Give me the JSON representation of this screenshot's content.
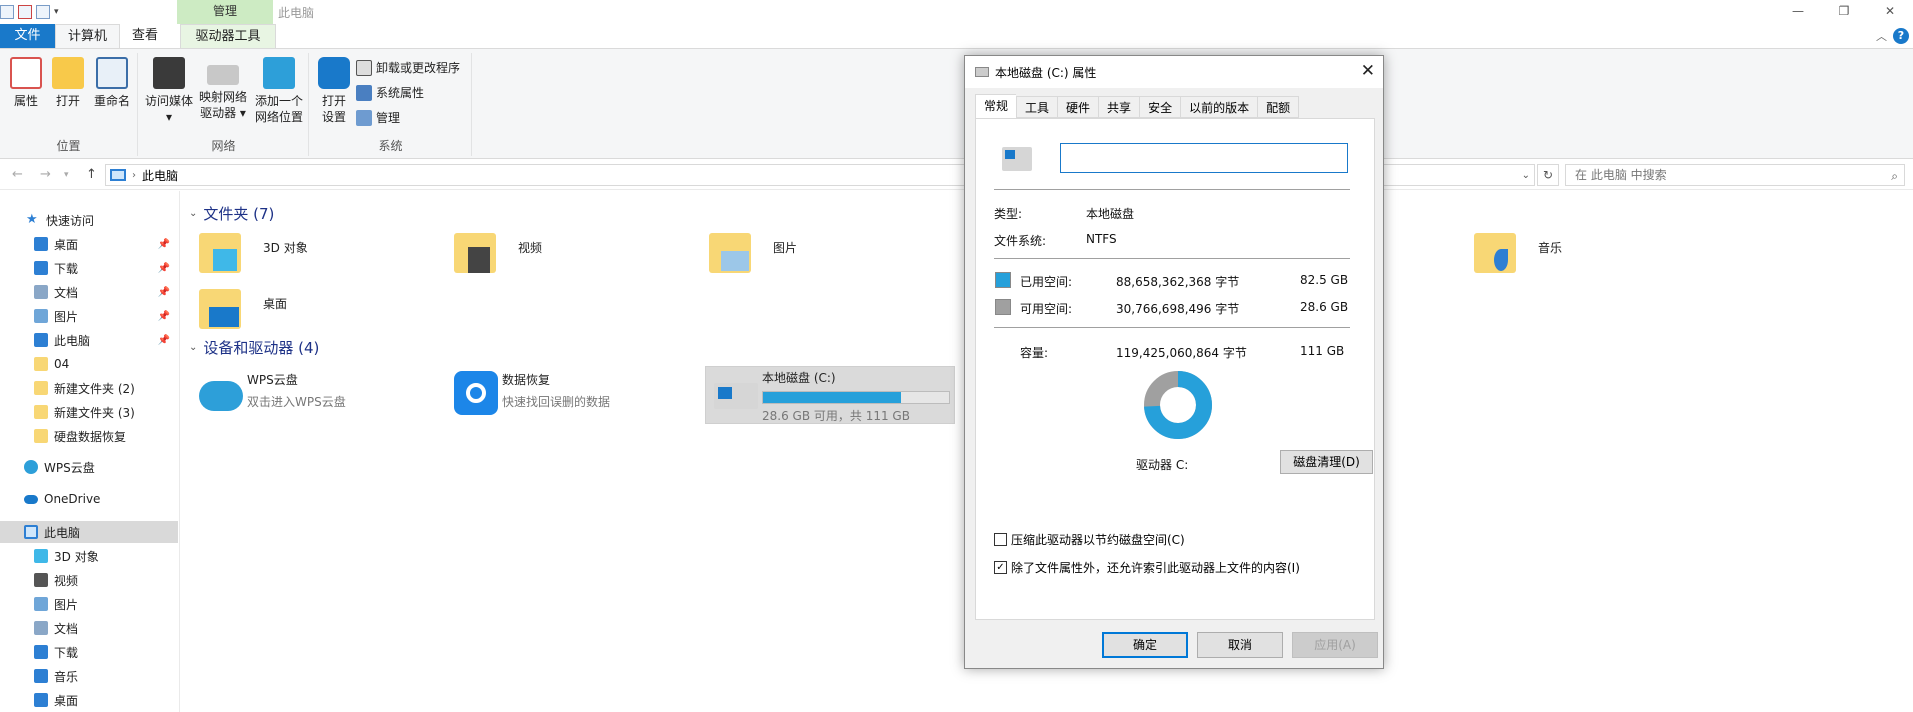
{
  "window": {
    "title": "此电脑",
    "context_tab": "管理",
    "controls": [
      "—",
      "❐",
      "✕"
    ]
  },
  "tabs": [
    {
      "label": "文件"
    },
    {
      "label": "计算机"
    },
    {
      "label": "查看"
    },
    {
      "label": "驱动器工具"
    }
  ],
  "ribbon": {
    "location": {
      "label": "位置",
      "buttons": [
        "属性",
        "打开",
        "重命名"
      ]
    },
    "network": {
      "label": "网络",
      "access": [
        "访问媒体",
        "▾"
      ],
      "map": [
        "映射网络",
        "驱动器 ▾"
      ],
      "add": [
        "添加一个",
        "网络位置"
      ]
    },
    "system": {
      "label": "系统",
      "open": [
        "打开",
        "设置"
      ],
      "uninstall": "卸载或更改程序",
      "sysprop": "系统属性",
      "manage": "管理"
    }
  },
  "address": {
    "path": "此电脑",
    "search_placeholder": "在 此电脑 中搜索"
  },
  "sidebar": {
    "quick_access": "快速访问",
    "items": [
      {
        "label": "桌面",
        "icon": "desktop-icon",
        "color": "#2d7fd3",
        "pinned": true
      },
      {
        "label": "下载",
        "icon": "download-icon",
        "color": "#2d7fd3",
        "pinned": true
      },
      {
        "label": "文档",
        "icon": "document-icon",
        "color": "#8aa7c7",
        "pinned": true
      },
      {
        "label": "图片",
        "icon": "pictures-icon",
        "color": "#6fa6d8",
        "pinned": true
      },
      {
        "label": "此电脑",
        "icon": "pc-icon",
        "color": "#2d7fd3",
        "pinned": true
      },
      {
        "label": "04",
        "icon": "folder-icon",
        "color": "#f8d775",
        "pinned": false
      },
      {
        "label": "新建文件夹 (2)",
        "icon": "folder-icon",
        "color": "#f8d775",
        "pinned": false
      },
      {
        "label": "新建文件夹 (3)",
        "icon": "folder-icon",
        "color": "#f8d775",
        "pinned": false
      },
      {
        "label": "硬盘数据恢复",
        "icon": "folder-icon",
        "color": "#f8d775",
        "pinned": false
      }
    ],
    "wps": "WPS云盘",
    "onedrive": "OneDrive",
    "this_pc": "此电脑",
    "pc_items": [
      {
        "label": "3D 对象",
        "icon": "3d-objects-icon",
        "color": "#3fb8e8"
      },
      {
        "label": "视频",
        "icon": "video-icon",
        "color": "#555555"
      },
      {
        "label": "图片",
        "icon": "pictures-icon",
        "color": "#6fa6d8"
      },
      {
        "label": "文档",
        "icon": "document-icon",
        "color": "#8aa7c7"
      },
      {
        "label": "下载",
        "icon": "download-icon",
        "color": "#2d7fd3"
      },
      {
        "label": "音乐",
        "icon": "music-icon",
        "color": "#2d7fd3"
      },
      {
        "label": "桌面",
        "icon": "desktop-icon",
        "color": "#2d7fd3"
      }
    ]
  },
  "content": {
    "folders_title": "文件夹 (7)",
    "folders": [
      "3D 对象",
      "视频",
      "图片",
      "音乐",
      "桌面"
    ],
    "devices_title": "设备和驱动器 (4)",
    "devices": [
      {
        "name": "WPS云盘",
        "sub": "双击进入WPS云盘"
      },
      {
        "name": "数据恢复",
        "sub": "快速找回误删的数据"
      },
      {
        "name": "本地磁盘 (C:)",
        "sub": "28.6 GB 可用，共 111 GB",
        "used_fraction": 0.742
      }
    ]
  },
  "dialog": {
    "title": "本地磁盘 (C:) 属性",
    "tabs": [
      "常规",
      "工具",
      "硬件",
      "共享",
      "安全",
      "以前的版本",
      "配额"
    ],
    "drive_name_value": "",
    "type_label": "类型:",
    "type_value": "本地磁盘",
    "fs_label": "文件系统:",
    "fs_value": "NTFS",
    "used_label": "已用空间:",
    "used_bytes": "88,658,362,368 字节",
    "used_gb": "82.5 GB",
    "free_label": "可用空间:",
    "free_bytes": "30,766,698,496 字节",
    "free_gb": "28.6 GB",
    "cap_label": "容量:",
    "cap_bytes": "119,425,060,864 字节",
    "cap_gb": "111 GB",
    "drive_label": "驱动器 C:",
    "cleanup_button": "磁盘清理(D)",
    "compress_label": "压缩此驱动器以节约磁盘空间(C)",
    "compress_checked": false,
    "index_label": "除了文件属性外，还允许索引此驱动器上文件的内容(I)",
    "index_checked": true,
    "ok": "确定",
    "cancel": "取消",
    "apply": "应用(A)",
    "used_color": "#26a0da",
    "free_color": "#a0a0a0",
    "used_fraction": 0.7424
  }
}
